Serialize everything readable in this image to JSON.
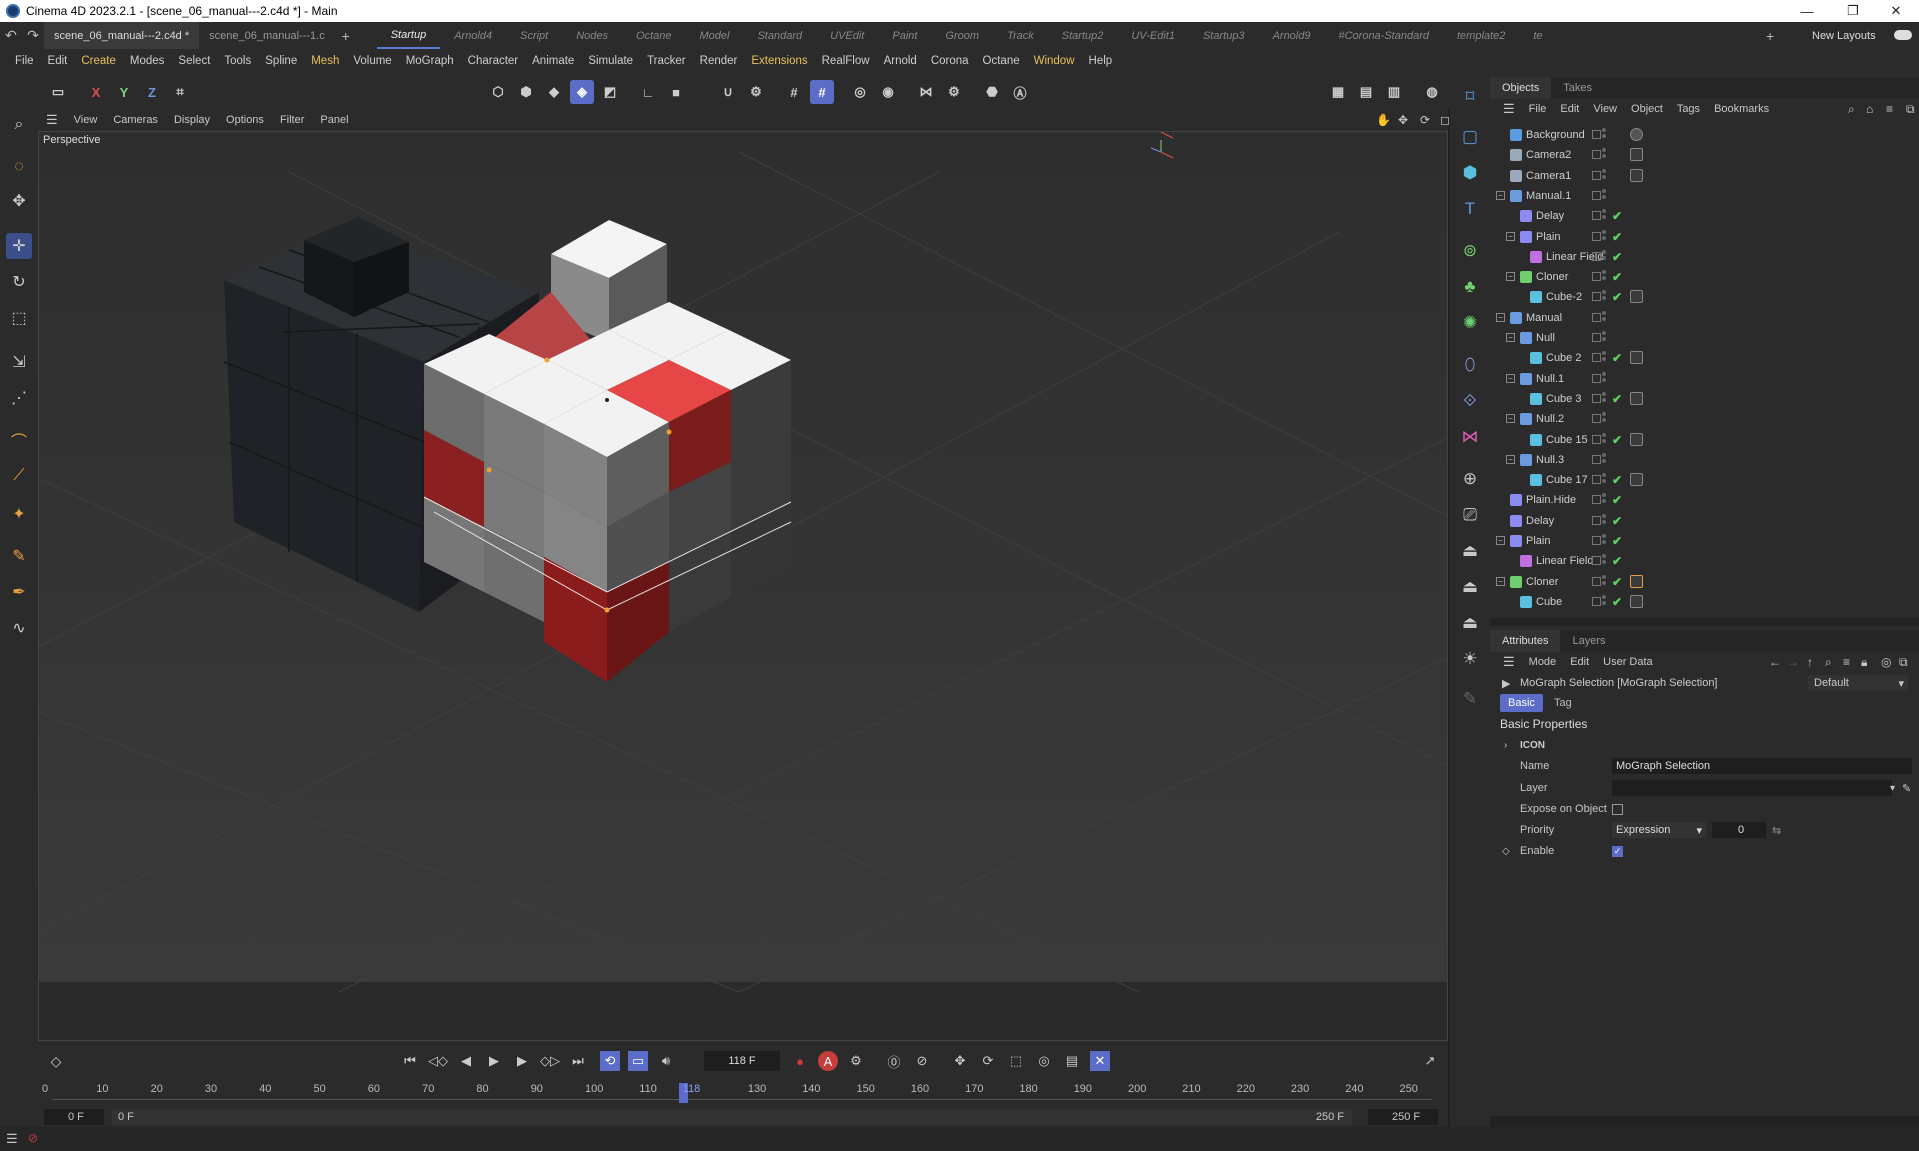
{
  "window": {
    "title": "Cinema 4D 2023.2.1 - [scene_06_manual---2.c4d *] - Main",
    "minimize": "—",
    "maximize": "❐",
    "close": "✕"
  },
  "doc_tabs": [
    "scene_06_manual---2.c4d *",
    "scene_06_manual---1.c"
  ],
  "layout_tabs": [
    "Startup",
    "Arnold4",
    "Script",
    "Nodes",
    "Octane",
    "Model",
    "Standard",
    "UVEdit",
    "Paint",
    "Groom",
    "Track",
    "Startup2",
    "UV-Edit1",
    "Startup3",
    "Arnold9",
    "#Corona-Standard",
    "template2",
    "te"
  ],
  "new_layouts": "New Layouts",
  "menu": [
    "File",
    "Edit",
    "Create",
    "Modes",
    "Select",
    "Tools",
    "Spline",
    "Mesh",
    "Volume",
    "MoGraph",
    "Character",
    "Animate",
    "Simulate",
    "Tracker",
    "Render",
    "Extensions",
    "RealFlow",
    "Arnold",
    "Corona",
    "Octane",
    "Window",
    "Help"
  ],
  "menu_highlight": [
    "Create",
    "Mesh",
    "Extensions",
    "Window"
  ],
  "axis_buttons": [
    "X",
    "Y",
    "Z"
  ],
  "viewport": {
    "menu": [
      "View",
      "Cameras",
      "Display",
      "Options",
      "Filter",
      "Panel"
    ],
    "label": "Perspective"
  },
  "objects_panel": {
    "tabs": [
      "Objects",
      "Takes"
    ],
    "menu": [
      "File",
      "Edit",
      "View",
      "Object",
      "Tags",
      "Bookmarks"
    ],
    "rows": [
      {
        "name": "Background",
        "depth": 0,
        "icon": "background-icon",
        "expand": "",
        "check": false,
        "tag": "material-tag"
      },
      {
        "name": "Camera2",
        "depth": 0,
        "icon": "camera-icon",
        "expand": "",
        "check": false,
        "tag": "protection-tag"
      },
      {
        "name": "Camera1",
        "depth": 0,
        "icon": "camera-icon",
        "expand": "",
        "check": false,
        "tag": "protection-tag"
      },
      {
        "name": "Manual.1",
        "depth": 0,
        "icon": "null-icon",
        "expand": "−",
        "check": false,
        "tag": ""
      },
      {
        "name": "Delay",
        "depth": 1,
        "icon": "effector-icon",
        "expand": "",
        "check": true,
        "tag": ""
      },
      {
        "name": "Plain",
        "depth": 1,
        "icon": "effector-icon",
        "expand": "−",
        "check": true,
        "tag": ""
      },
      {
        "name": "Linear Field",
        "depth": 2,
        "icon": "field-icon",
        "expand": "",
        "check": true,
        "tag": ""
      },
      {
        "name": "Cloner",
        "depth": 1,
        "icon": "cloner-icon",
        "expand": "−",
        "check": true,
        "tag": ""
      },
      {
        "name": "Cube-2",
        "depth": 2,
        "icon": "cube-icon",
        "expand": "",
        "check": true,
        "tag": "selection-tag"
      },
      {
        "name": "Manual",
        "depth": 0,
        "icon": "null-icon",
        "expand": "−",
        "check": false,
        "tag": ""
      },
      {
        "name": "Null",
        "depth": 1,
        "icon": "null-icon",
        "expand": "−",
        "check": false,
        "tag": ""
      },
      {
        "name": "Cube 2",
        "depth": 2,
        "icon": "cube-icon",
        "expand": "",
        "check": true,
        "tag": "selection-tag"
      },
      {
        "name": "Null.1",
        "depth": 1,
        "icon": "null-icon",
        "expand": "−",
        "check": false,
        "tag": ""
      },
      {
        "name": "Cube 3",
        "depth": 2,
        "icon": "cube-icon",
        "expand": "",
        "check": true,
        "tag": "selection-tag"
      },
      {
        "name": "Null.2",
        "depth": 1,
        "icon": "null-icon",
        "expand": "−",
        "check": false,
        "tag": ""
      },
      {
        "name": "Cube 15",
        "depth": 2,
        "icon": "cube-icon",
        "expand": "",
        "check": true,
        "tag": "selection-tag"
      },
      {
        "name": "Null.3",
        "depth": 1,
        "icon": "null-icon",
        "expand": "−",
        "check": false,
        "tag": ""
      },
      {
        "name": "Cube 17",
        "depth": 2,
        "icon": "cube-icon",
        "expand": "",
        "check": true,
        "tag": "selection-tag"
      },
      {
        "name": "Plain.Hide",
        "depth": 0,
        "icon": "effector-icon",
        "expand": "",
        "check": true,
        "tag": ""
      },
      {
        "name": "Delay",
        "depth": 0,
        "icon": "effector-icon",
        "expand": "",
        "check": true,
        "tag": ""
      },
      {
        "name": "Plain",
        "depth": 0,
        "icon": "effector-icon",
        "expand": "−",
        "check": true,
        "tag": ""
      },
      {
        "name": "Linear Field",
        "depth": 1,
        "icon": "field-icon",
        "expand": "",
        "check": true,
        "tag": ""
      },
      {
        "name": "Cloner",
        "depth": 0,
        "icon": "cloner-icon",
        "expand": "−",
        "check": true,
        "tag": "selection-tag-active"
      },
      {
        "name": "Cube",
        "depth": 1,
        "icon": "cube-icon",
        "expand": "",
        "check": true,
        "tag": "selection-tag"
      }
    ]
  },
  "attributes_panel": {
    "tabs": [
      "Attributes",
      "Layers"
    ],
    "menu": [
      "Mode",
      "Edit",
      "User Data"
    ],
    "object_title": "MoGraph Selection [MoGraph Selection]",
    "preset": "Default",
    "sub_tabs": [
      "Basic",
      "Tag"
    ],
    "section": "Basic Properties",
    "icon_group": "ICON",
    "fields": {
      "name_label": "Name",
      "name_value": "MoGraph Selection",
      "layer_label": "Layer",
      "expose_label": "Expose on Object",
      "priority_label": "Priority",
      "priority_value": "Expression",
      "priority_number": "0",
      "enable_label": "Enable"
    }
  },
  "timeline": {
    "current_frame": "118 F",
    "ticks": [
      "0",
      "10",
      "20",
      "30",
      "40",
      "50",
      "60",
      "70",
      "80",
      "90",
      "100",
      "110",
      "118",
      "130",
      "140",
      "150",
      "160",
      "170",
      "180",
      "190",
      "200",
      "210",
      "220",
      "230",
      "240",
      "250"
    ],
    "start_a": "0 F",
    "start_b": "0 F",
    "end_a": "250 F",
    "end_b": "250 F"
  },
  "colors": {
    "accent": "#5b6dc8",
    "check": "#5fd15f",
    "highlight_menu": "#e8c15a",
    "record": "#c83c3c"
  }
}
